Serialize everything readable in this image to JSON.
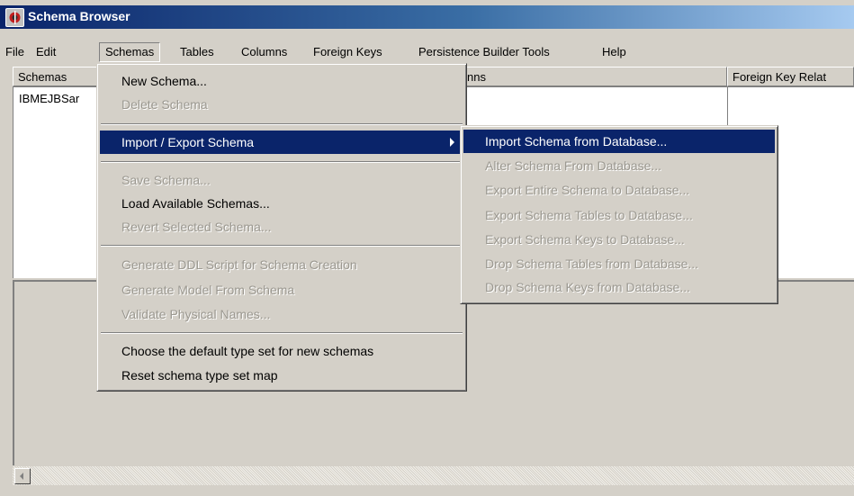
{
  "window": {
    "title": "Schema Browser",
    "icon": "app-icon"
  },
  "menubar": [
    "File",
    "Edit",
    "Schemas",
    "Tables",
    "Columns",
    "Foreign Keys",
    "Persistence Builder Tools",
    "Help"
  ],
  "panes": {
    "schemas_header": "Schemas",
    "columns_header_fragment": "nns",
    "foreign_keys_header": "Foreign Key Relat",
    "schemas_list": [
      "IBMEJBSar"
    ]
  },
  "schemas_menu": {
    "new_schema": "New Schema...",
    "delete_schema": "Delete Schema",
    "import_export": "Import / Export Schema",
    "save_schema": "Save Schema...",
    "load_available": "Load Available Schemas...",
    "revert_selected": "Revert Selected Schema...",
    "generate_ddl": "Generate DDL Script for Schema Creation",
    "generate_model": "Generate Model From Schema",
    "validate_names": "Validate Physical Names...",
    "choose_default": "Choose the default type set for new schemas",
    "reset_map": "Reset schema type set map"
  },
  "import_export_submenu": {
    "import_from_db": "Import Schema from Database...",
    "alter_from_db": "Alter Schema From Database...",
    "export_entire": "Export Entire Schema to Database...",
    "export_tables": "Export Schema Tables to Database...",
    "export_keys": "Export Schema Keys to Database...",
    "drop_tables": "Drop Schema Tables from Database...",
    "drop_keys": "Drop Schema Keys from Database..."
  },
  "colors": {
    "highlight": "#0a246a",
    "face": "#d4d0c8",
    "disabled_text": "#9b9890"
  }
}
